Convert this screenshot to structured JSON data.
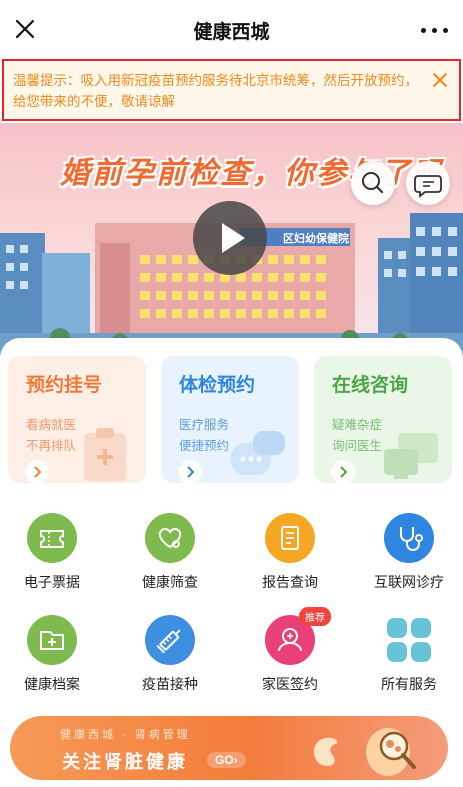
{
  "topbar": {
    "title": "健康西城"
  },
  "notice": {
    "text": "温馨提示：吸入用新冠疫苗预约服务待北京市统筹，然后开放预约，给您带来的不便，敬请谅解"
  },
  "banner": {
    "headline": "婚前孕前检查，你参与了吗",
    "building_sign": "区妇幼保健院"
  },
  "cards": [
    {
      "title": "预约挂号",
      "line1": "看病就医",
      "line2": "不再排队",
      "color": "#f07a3a",
      "bg": "#fdeee6"
    },
    {
      "title": "体检预约",
      "line1": "医疗服务",
      "line2": "便捷预约",
      "color": "#2f86e0",
      "bg": "#e8f3fd"
    },
    {
      "title": "在线咨询",
      "line1": "疑难杂症",
      "line2": "询问医生",
      "color": "#4aa545",
      "bg": "#eaf6e8"
    }
  ],
  "grid": [
    {
      "label": "电子票据",
      "icon": "ticket-icon",
      "color": "#7fba4e"
    },
    {
      "label": "健康筛查",
      "icon": "heart-stethoscope-icon",
      "color": "#7fba4e"
    },
    {
      "label": "报告查询",
      "icon": "report-icon",
      "color": "#f5a623"
    },
    {
      "label": "互联网诊疗",
      "icon": "stethoscope-icon",
      "color": "#2f86e0"
    },
    {
      "label": "健康档案",
      "icon": "folder-plus-icon",
      "color": "#7fba4e"
    },
    {
      "label": "疫苗接种",
      "icon": "syringe-icon",
      "color": "#3d8fe0"
    },
    {
      "label": "家医签约",
      "icon": "doctor-icon",
      "color": "#ea3f78",
      "badge": "推荐"
    },
    {
      "label": "所有服务",
      "icon": "grid-icon",
      "color": "#66c3d6"
    }
  ],
  "promo": {
    "subtitle": "健康西城 · 肾病管理",
    "title": "关注肾脏健康",
    "go": "GO›"
  }
}
